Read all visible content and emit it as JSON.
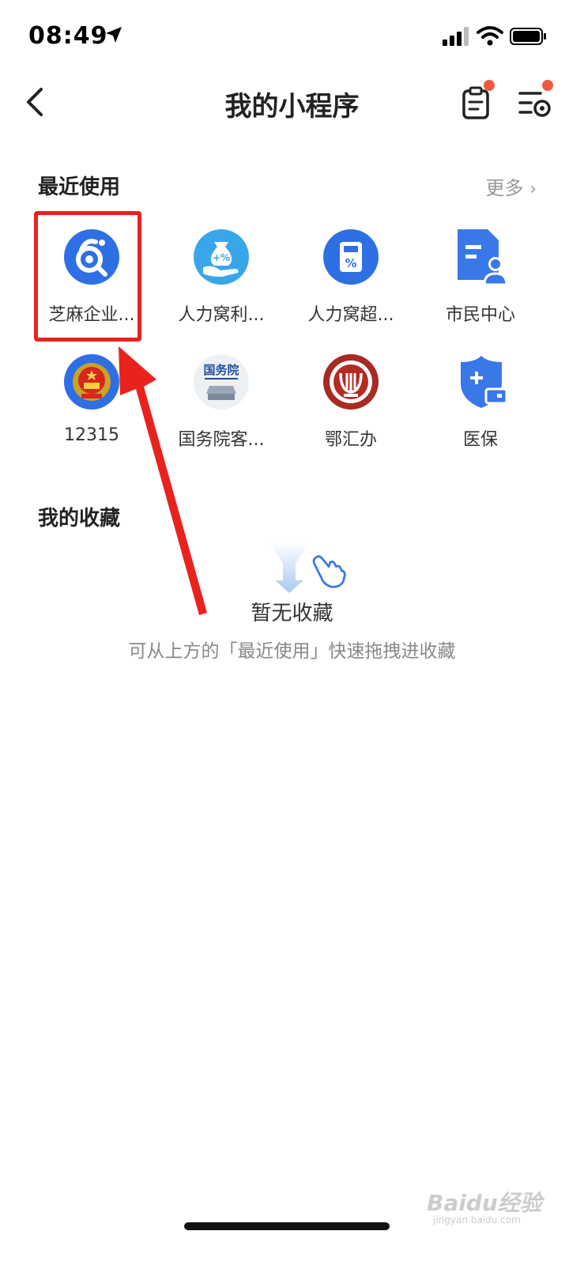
{
  "status_bar": {
    "time": "08:49"
  },
  "nav": {
    "title": "我的小程序"
  },
  "recent": {
    "title": "最近使用",
    "more": "更多",
    "apps": [
      {
        "label": "芝麻企业..."
      },
      {
        "label": "人力窝利..."
      },
      {
        "label": "人力窝超..."
      },
      {
        "label": "市民中心"
      },
      {
        "label": "12315"
      },
      {
        "label": "国务院客..."
      },
      {
        "label": "鄂汇办"
      },
      {
        "label": "医保"
      }
    ]
  },
  "favorites": {
    "title": "我的收藏",
    "empty_title": "暂无收藏",
    "empty_hint": "可从上方的「最近使用」快速拖拽进收藏"
  },
  "icon_labels": {
    "guowuyuan": "国务院"
  },
  "watermark": {
    "brand": "Baidu经验",
    "url": "jingyan.baidu.com"
  },
  "colors": {
    "accent_blue": "#3a78e8",
    "badge_red": "#f05a3c",
    "highlight_red": "#e8231e"
  }
}
